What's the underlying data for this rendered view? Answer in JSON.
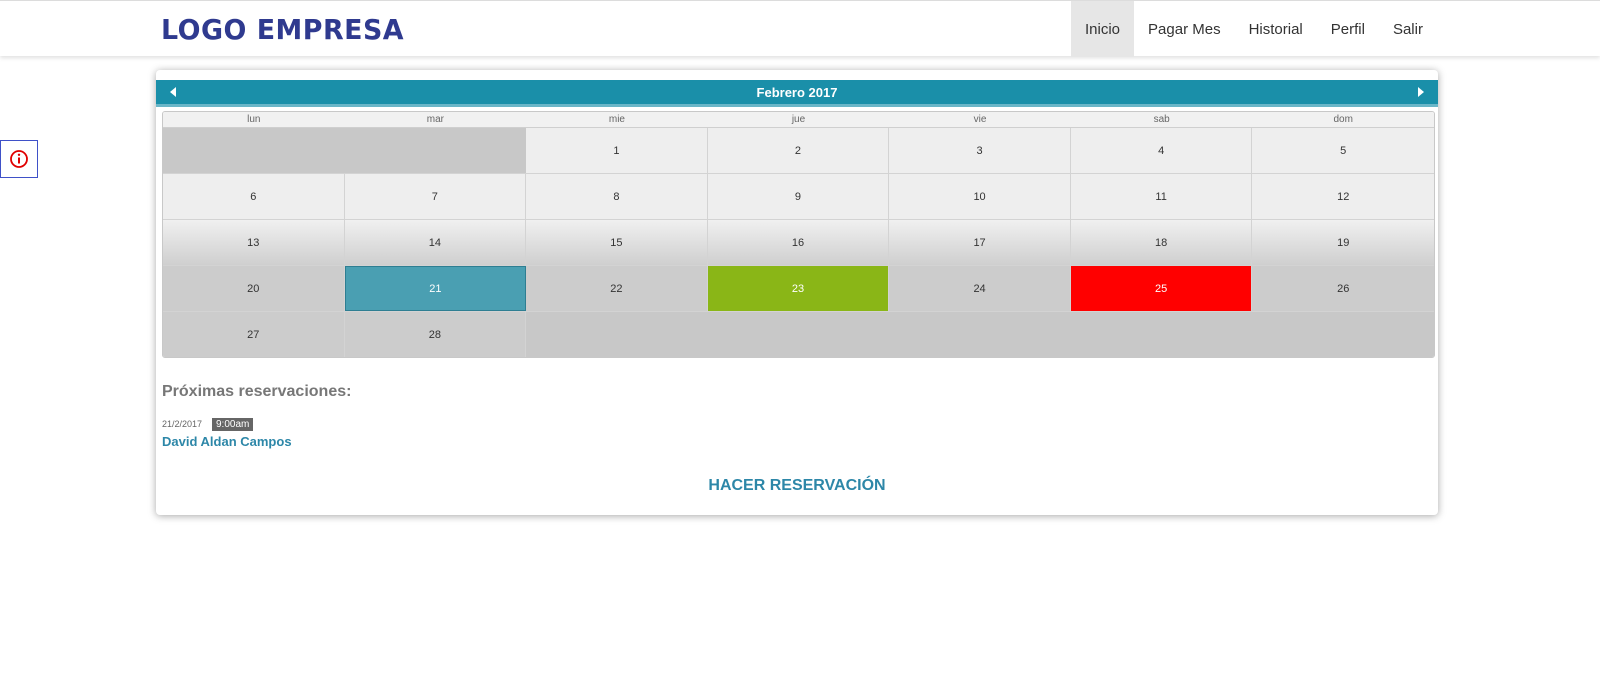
{
  "brand": {
    "logo_text": "LOGO EMPRESA"
  },
  "nav": {
    "items": [
      {
        "label": "Inicio",
        "active": true
      },
      {
        "label": "Pagar Mes"
      },
      {
        "label": "Historial"
      },
      {
        "label": "Perfil"
      },
      {
        "label": "Salir"
      }
    ]
  },
  "info_badge": {
    "icon": "info-icon",
    "color": "#e00000"
  },
  "calendar": {
    "month_label": "Febrero 2017",
    "weekdays": [
      "lun",
      "mar",
      "mie",
      "jue",
      "vie",
      "sab",
      "dom"
    ],
    "weeks": [
      [
        "",
        "",
        "1",
        "2",
        "3",
        "4",
        "5"
      ],
      [
        "6",
        "7",
        "8",
        "9",
        "10",
        "11",
        "12"
      ],
      [
        "13",
        "14",
        "15",
        "16",
        "17",
        "18",
        "19"
      ],
      [
        "20",
        "21",
        "22",
        "23",
        "24",
        "25",
        "26"
      ],
      [
        "27",
        "28",
        "",
        "",
        "",
        "",
        ""
      ]
    ],
    "highlights": {
      "selected": "21",
      "green": "23",
      "red": "25"
    },
    "colors": {
      "header": "#1a8fa9",
      "selected": "#4a9fb2",
      "green": "#8ab617",
      "red": "#ff0000"
    }
  },
  "reservations": {
    "title": "Próximas reservaciones:",
    "items": [
      {
        "date": "21/2/2017",
        "time": "9:00am",
        "name": "David Aldan Campos"
      }
    ]
  },
  "actions": {
    "reserve_label": "HACER RESERVACIÓN"
  }
}
